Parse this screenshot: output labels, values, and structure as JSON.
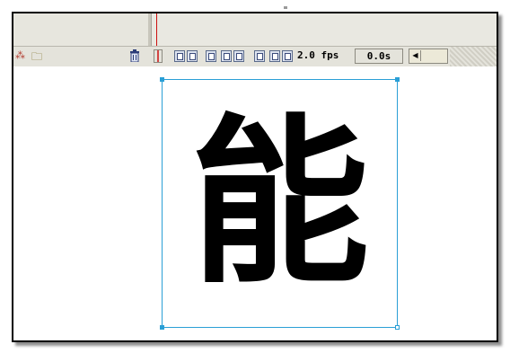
{
  "timeline": {
    "frame_rate": "2.0 fps",
    "elapsed_time": "0.0s"
  },
  "stage": {
    "text_symbol": "能"
  },
  "icons": {
    "layer_tools": "add-motion-guide-icon",
    "folder": "insert-layer-folder-icon",
    "trash": "delete-layer-icon",
    "onion_skin": "onion-skin-icon"
  },
  "colors": {
    "selection": "#2a9fd6",
    "playhead": "#cc1010",
    "panel": "#e7e6de"
  }
}
